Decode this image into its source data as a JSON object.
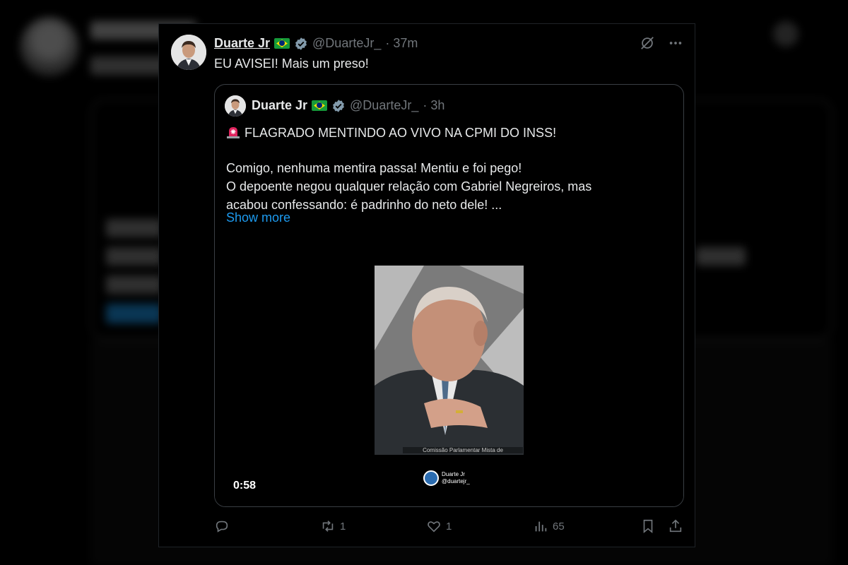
{
  "tweet": {
    "author_name": "Duarte Jr",
    "handle": "@DuarteJr_",
    "time": "· 37m",
    "text": "EU AVISEI! Mais um preso!"
  },
  "quoted_tweet": {
    "author_name": "Duarte Jr",
    "handle": "@DuarteJr_",
    "time": "· 3h",
    "line1": "FLAGRADO MENTINDO AO VIVO NA CPMI DO INSS!",
    "line2": "Comigo, nenhuma mentira passa! Mentiu e foi pego!",
    "line3": "O depoente negou qualquer relação com Gabriel Negreiros, mas",
    "line4": "acabou confessando: é padrinho do neto dele! ...",
    "show_more": "Show more",
    "video": {
      "duration": "0:58",
      "watermark_name": "Duarte Jr",
      "watermark_handle": "@duartejr_",
      "caption": "Comissão Parlamentar Mista de"
    }
  },
  "actions": {
    "replies": "",
    "reposts": "1",
    "likes": "1",
    "views": "65"
  },
  "icons": {
    "grok": "grok-icon",
    "more": "more-icon",
    "reply": "reply-icon",
    "repost": "repost-icon",
    "like": "heart-icon",
    "views": "views-icon",
    "bookmark": "bookmark-icon",
    "share": "share-icon"
  },
  "colors": {
    "background": "#000000",
    "text": "#e7e9ea",
    "muted": "#71767b",
    "link": "#1d9bf0",
    "verified": "#829aab"
  }
}
